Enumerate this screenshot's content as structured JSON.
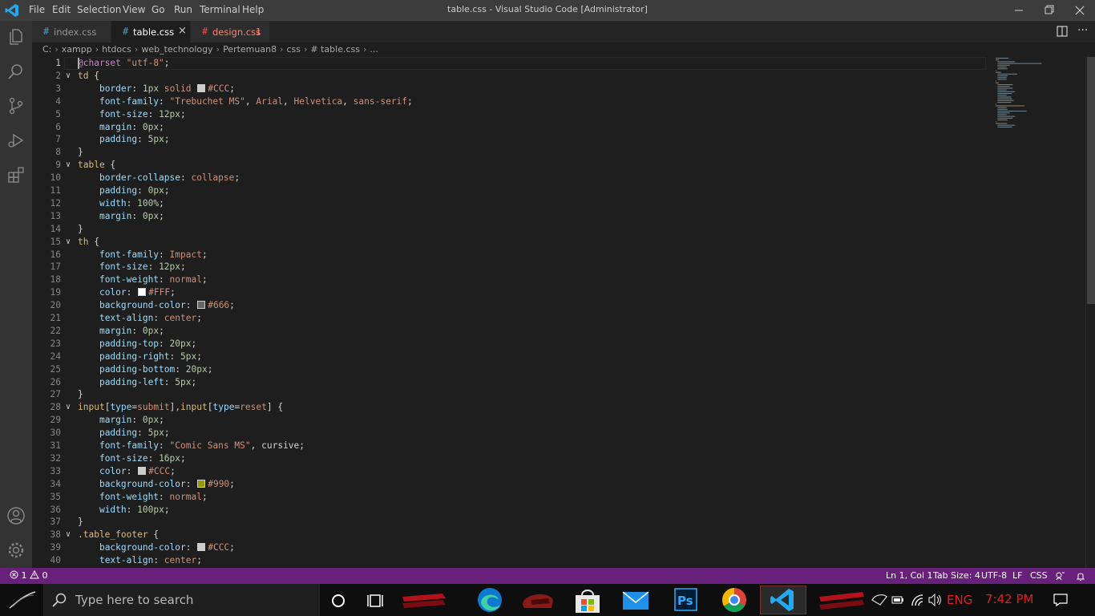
{
  "menu": [
    "File",
    "Edit",
    "Selection",
    "View",
    "Go",
    "Run",
    "Terminal",
    "Help"
  ],
  "window_title": "table.css - Visual Studio Code [Administrator]",
  "tabs": [
    {
      "label": "index.css",
      "badge": ""
    },
    {
      "label": "table.css",
      "badge": ""
    },
    {
      "label": "design.css",
      "badge": "1"
    }
  ],
  "breadcrumb": [
    "C:",
    "xampp",
    "htdocs",
    "web_technology",
    "Pertemuan8",
    "css",
    "# table.css",
    "..."
  ],
  "code_lines": [
    {
      "num": "1",
      "text": "@charset \"utf-8\";"
    },
    {
      "num": "2",
      "text": "td {"
    },
    {
      "num": "3",
      "text": "    border: 1px solid #CCC;"
    },
    {
      "num": "4",
      "text": "    font-family: \"Trebuchet MS\", Arial, Helvetica, sans-serif;"
    },
    {
      "num": "5",
      "text": "    font-size: 12px;"
    },
    {
      "num": "6",
      "text": "    margin: 0px;"
    },
    {
      "num": "7",
      "text": "    padding: 5px;"
    },
    {
      "num": "8",
      "text": "}"
    },
    {
      "num": "9",
      "text": "table {"
    },
    {
      "num": "10",
      "text": "    border-collapse: collapse;"
    },
    {
      "num": "11",
      "text": "    padding: 0px;"
    },
    {
      "num": "12",
      "text": "    width: 100%;"
    },
    {
      "num": "13",
      "text": "    margin: 0px;"
    },
    {
      "num": "14",
      "text": "}"
    },
    {
      "num": "15",
      "text": "th {"
    },
    {
      "num": "16",
      "text": "    font-family: Impact;"
    },
    {
      "num": "17",
      "text": "    font-size: 12px;"
    },
    {
      "num": "18",
      "text": "    font-weight: normal;"
    },
    {
      "num": "19",
      "text": "    color: #FFF;"
    },
    {
      "num": "20",
      "text": "    background-color: #666;"
    },
    {
      "num": "21",
      "text": "    text-align: center;"
    },
    {
      "num": "22",
      "text": "    margin: 0px;"
    },
    {
      "num": "23",
      "text": "    padding-top: 20px;"
    },
    {
      "num": "24",
      "text": "    padding-right: 5px;"
    },
    {
      "num": "25",
      "text": "    padding-bottom: 20px;"
    },
    {
      "num": "26",
      "text": "    padding-left: 5px;"
    },
    {
      "num": "27",
      "text": "}"
    },
    {
      "num": "28",
      "text": "input[type=submit],input[type=reset] {"
    },
    {
      "num": "29",
      "text": "    margin: 0px;"
    },
    {
      "num": "30",
      "text": "    padding: 5px;"
    },
    {
      "num": "31",
      "text": "    font-family: \"Comic Sans MS\", cursive;"
    },
    {
      "num": "32",
      "text": "    font-size: 16px;"
    },
    {
      "num": "33",
      "text": "    color: #CCC;"
    },
    {
      "num": "34",
      "text": "    background-color: #990;"
    },
    {
      "num": "35",
      "text": "    font-weight: normal;"
    },
    {
      "num": "36",
      "text": "    width: 100px;"
    },
    {
      "num": "37",
      "text": "}"
    },
    {
      "num": "38",
      "text": ".table_footer {"
    },
    {
      "num": "39",
      "text": "    background-color: #CCC;"
    },
    {
      "num": "40",
      "text": "    text-align: center;"
    }
  ],
  "swatch_colors": {
    "#CCC": "#cccccc",
    "#FFF": "#ffffff",
    "#666": "#666666",
    "#990": "#999900"
  },
  "status": {
    "errors": "1",
    "warnings": "0",
    "position": "Ln 1, Col 1",
    "tab_size": "Tab Size: 4",
    "encoding": "UTF-8",
    "eol": "LF",
    "language": "CSS"
  },
  "taskbar": {
    "search_placeholder": "Type here to search",
    "language": "ENG",
    "time": "7:42 PM"
  },
  "colors": {
    "statusbar": "#68217a",
    "accent": "#007acc",
    "clock": "#e02020"
  }
}
